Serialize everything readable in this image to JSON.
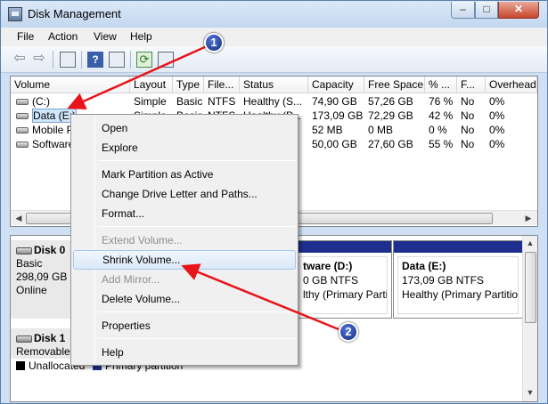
{
  "window": {
    "title": "Disk Management",
    "min_label": "–",
    "max_label": "□",
    "close_label": "✕"
  },
  "menu": [
    "File",
    "Action",
    "View",
    "Help"
  ],
  "toolbar": {
    "icons": [
      "back-arrow-icon",
      "forward-arrow-icon",
      "console-tree-icon",
      "help-icon",
      "properties-icon",
      "refresh-icon",
      "rescan-icon"
    ],
    "help_glyph": "?",
    "refresh_glyph": "⟳",
    "back_glyph": "⇦",
    "forward_glyph": "⇨"
  },
  "columns": [
    "Volume",
    "Layout",
    "Type",
    "File...",
    "Status",
    "Capacity",
    "Free Space",
    "% ...",
    "F...",
    "Overhead"
  ],
  "volumes": [
    {
      "volume": "(C:)",
      "layout": "Simple",
      "type": "Basic",
      "fs": "NTFS",
      "status": "Healthy (S...",
      "capacity": "74,90 GB",
      "free": "57,26 GB",
      "pct": "76 %",
      "f": "No",
      "overhead": "0%"
    },
    {
      "volume": "Data (E:)",
      "layout": "Simple",
      "type": "Basic",
      "fs": "NTFS",
      "status": "Healthy (P...",
      "capacity": "173,09 GB",
      "free": "72,29 GB",
      "pct": "42 %",
      "f": "No",
      "overhead": "0%"
    },
    {
      "volume": "Mobile P",
      "layout": "",
      "type": "",
      "fs": "",
      "status": "",
      "capacity": "52 MB",
      "free": "0 MB",
      "pct": "0 %",
      "f": "No",
      "overhead": "0%"
    },
    {
      "volume": "Software",
      "layout": "",
      "type": "",
      "fs": "",
      "status": "",
      "capacity": "50,00 GB",
      "free": "27,60 GB",
      "pct": "55 %",
      "f": "No",
      "overhead": "0%"
    }
  ],
  "disks": [
    {
      "name": "Disk 0",
      "type": "Basic",
      "size": "298,09 GB",
      "state": "Online"
    },
    {
      "name": "Disk 1",
      "type": "Removable"
    }
  ],
  "partitions": [
    {
      "name": "tware  (D:)",
      "detail": "0 GB NTFS",
      "status": "lthy (Primary Parti"
    },
    {
      "name": "Data  (E:)",
      "detail": "173,09 GB NTFS",
      "status": "Healthy (Primary Partition"
    }
  ],
  "legend": [
    {
      "label": "Unallocated",
      "color": "#000000"
    },
    {
      "label": "Primary partition",
      "color": "#1e2f8f"
    }
  ],
  "context_menu": [
    {
      "label": "Open",
      "enabled": true
    },
    {
      "label": "Explore",
      "enabled": true
    },
    {
      "label": "Mark Partition as Active",
      "enabled": true
    },
    {
      "label": "Change Drive Letter and Paths...",
      "enabled": true
    },
    {
      "label": "Format...",
      "enabled": true
    },
    {
      "label": "Extend Volume...",
      "enabled": false
    },
    {
      "label": "Shrink Volume...",
      "enabled": true,
      "highlighted": true
    },
    {
      "label": "Add Mirror...",
      "enabled": false
    },
    {
      "label": "Delete Volume...",
      "enabled": true
    },
    {
      "label": "Properties",
      "enabled": true
    },
    {
      "label": "Help",
      "enabled": true
    }
  ],
  "annotations": {
    "step1": "1",
    "step2": "2",
    "arrow_color": "#e8141a"
  }
}
